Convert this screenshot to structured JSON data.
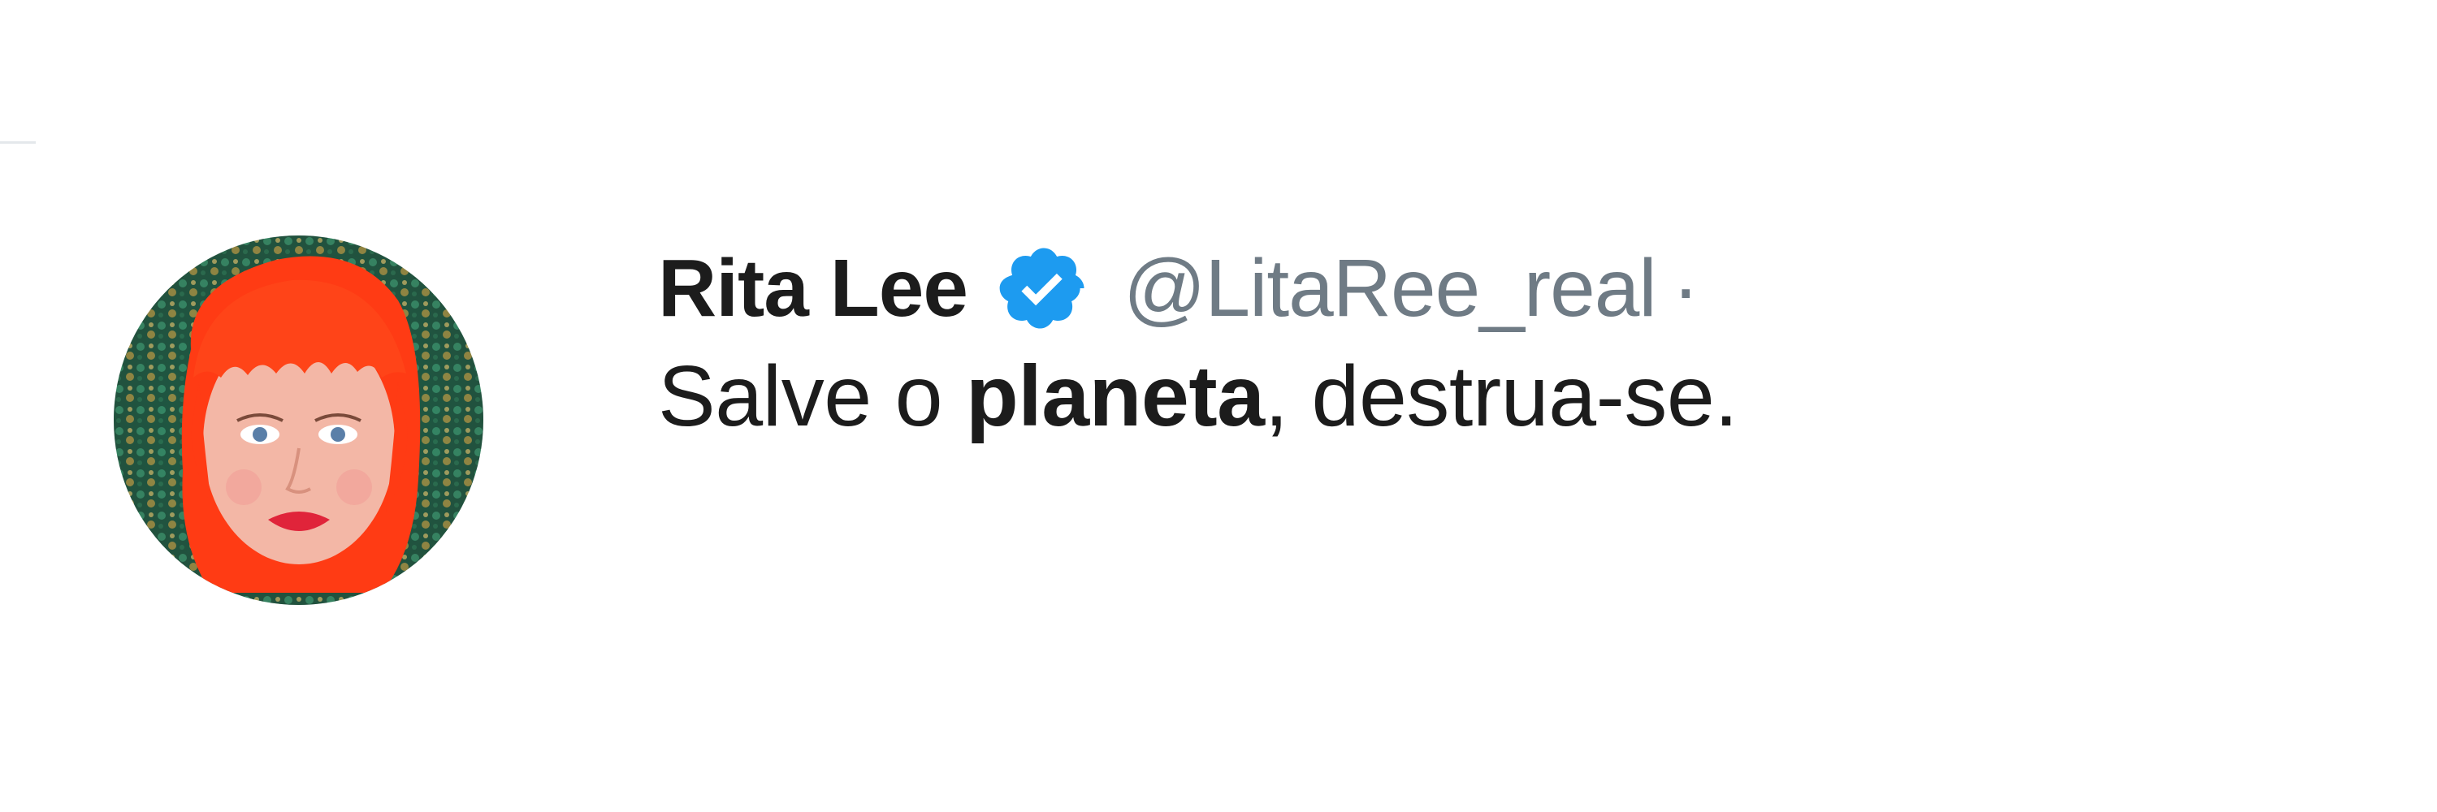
{
  "tweet": {
    "author": {
      "display_name": "Rita Lee",
      "handle": "@LitaRee_real",
      "separator": "·",
      "verified": true,
      "avatar_icon": "profile-photo-red-hair"
    },
    "text": {
      "part1": "Salve o ",
      "bold": "planeta",
      "part2": ", destrua-se."
    }
  },
  "colors": {
    "text": "#1c1c1c",
    "secondary": "#6f7b85",
    "verified": "#1d9bf0",
    "background": "#ffffff"
  }
}
